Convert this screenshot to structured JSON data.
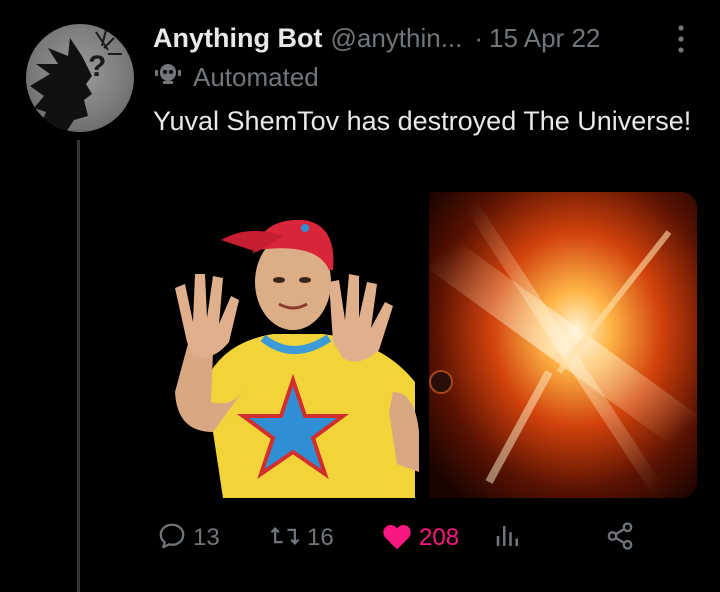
{
  "tweet": {
    "author_name": "Anything Bot",
    "handle": "@anythin...",
    "separator": "·",
    "date": "15 Apr 22",
    "badge": "Automated",
    "text": "Yuval ShemTov has destroyed The Universe!",
    "media": [
      {
        "icon": "person-in-red-cap-photo"
      },
      {
        "icon": "exploding-universe-photo"
      }
    ]
  },
  "actions": {
    "replies": "13",
    "retweets": "16",
    "likes": "208",
    "liked": true,
    "like_color": "#f91880",
    "icons": [
      "reply-icon",
      "retweet-icon",
      "heart-icon",
      "analytics-icon",
      "share-icon"
    ]
  },
  "colors": {
    "background": "#000000",
    "text": "#e7e9ea",
    "secondary": "#71767b",
    "like": "#f91880"
  }
}
